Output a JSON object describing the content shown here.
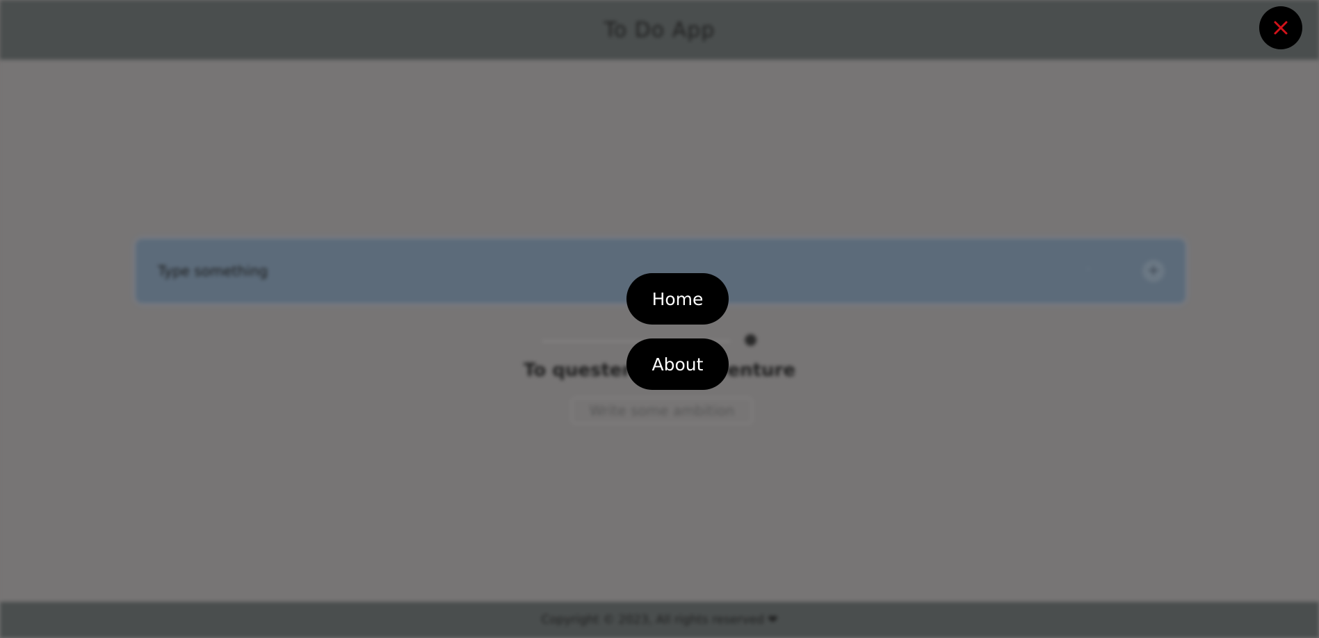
{
  "app": {
    "title": "To Do App",
    "header_icon": "check-icon"
  },
  "task_input": {
    "placeholder": "Type something"
  },
  "empty_state": {
    "title": "To quester-Your-Adventure",
    "hint": "Write some ambition"
  },
  "footer": {
    "text": "Copyright © 2023, All rights reserved ❤"
  },
  "menu": {
    "close_icon": "close-icon",
    "items": [
      {
        "label": "Home"
      },
      {
        "label": "About"
      }
    ]
  },
  "colors": {
    "close_icon": "#d2121a",
    "menu_button_bg": "#000000",
    "menu_button_text": "#ffffff"
  }
}
